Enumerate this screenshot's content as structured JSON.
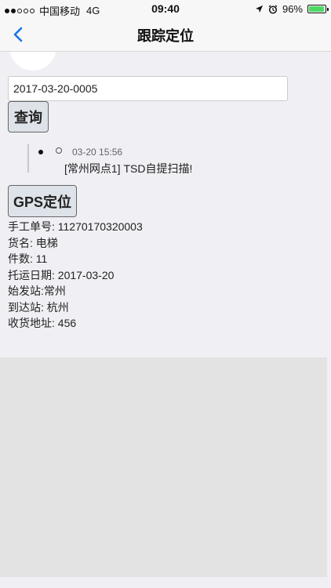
{
  "status_bar": {
    "carrier": "中国移动",
    "network": "4G",
    "time": "09:40",
    "battery": "96%",
    "battery_level": 0.96,
    "icons": [
      "signal-dots-icon",
      "location-arrow-icon",
      "alarm-icon",
      "battery-icon"
    ],
    "battery_color": "#4cd964"
  },
  "nav": {
    "title": "跟踪定位",
    "back_icon": "chevron-left-icon",
    "accent": "#1a73e8"
  },
  "search": {
    "value": "2017-03-20-0005"
  },
  "query_button": "查询",
  "timeline": [
    {
      "time": "03-20 15:56",
      "text": "[常州网点1] TSD自提扫描!"
    }
  ],
  "gps_button": "GPS定位",
  "info": {
    "manual_no": "手工单号: 11270170320003",
    "goods": "货名: 电梯",
    "count": "件数: 11",
    "ship_date": "托运日期: 2017-03-20",
    "origin": "始发站:常州",
    "destination": "到达站: 杭州",
    "address": "收货地址: 456"
  }
}
